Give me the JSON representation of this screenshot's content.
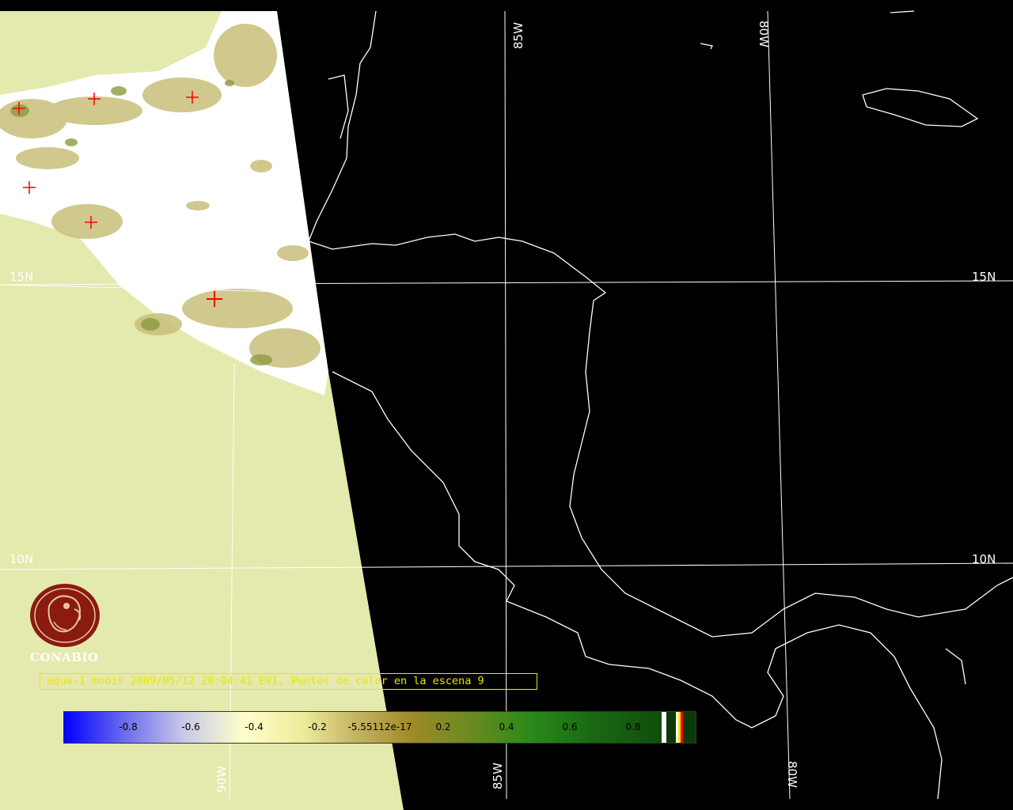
{
  "map": {
    "graticule": {
      "lon_labels_top": [
        "85W",
        "80W"
      ],
      "lon_labels_bottom": [
        "90W",
        "85W",
        "80W"
      ],
      "lat_labels_left": [
        "15N",
        "10N"
      ],
      "lat_labels_right": [
        "15N",
        "10N"
      ]
    },
    "hotspot_markers": [
      {
        "id": "hotspot-1"
      },
      {
        "id": "hotspot-2"
      },
      {
        "id": "hotspot-3"
      },
      {
        "id": "hotspot-4"
      },
      {
        "id": "hotspot-5"
      },
      {
        "id": "hotspot-6"
      }
    ],
    "colors": {
      "background_land": "#e4e9ad",
      "cloud_white": "#ffffff",
      "no_data": "#000000",
      "coastline": "#ffffff",
      "hotspot": "#ff0000",
      "caption": "#e8e800"
    }
  },
  "logo": {
    "icon": "conabio-macaw-icon",
    "name": "CONABIO",
    "color": "#8b1a10"
  },
  "caption": {
    "text": "aqua-1 modis 2009/05/12 20:04:41 EVI, Puntos de calor en la escena 9"
  },
  "colorbar": {
    "ticks": [
      "-0.8",
      "-0.6",
      "-0.4",
      "-0.2",
      "-5.55112e-17",
      "0.2",
      "0.4",
      "0.6",
      "0.8"
    ],
    "range": [
      -1.0,
      1.0
    ],
    "stops": [
      "#0000ff",
      "#ffffff",
      "#ffff99",
      "#a08a2a",
      "#1e8c1e",
      "#0a4a0a"
    ]
  }
}
